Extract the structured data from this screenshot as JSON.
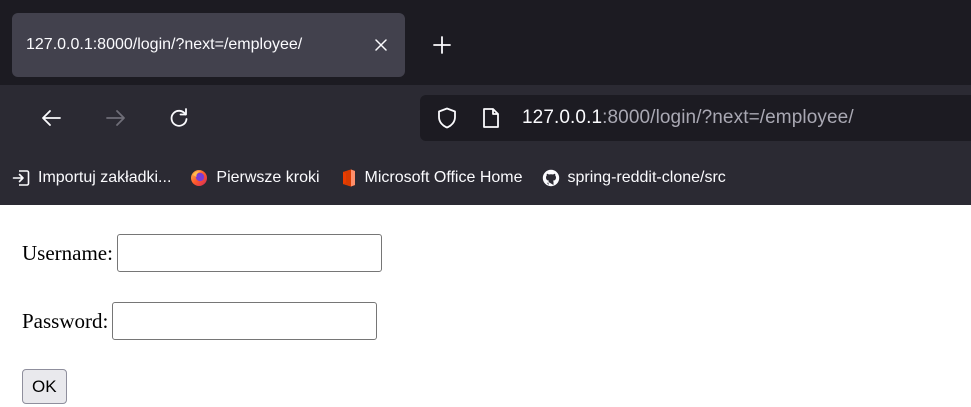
{
  "tab": {
    "title": "127.0.0.1:8000/login/?next=/employee/",
    "close_label": "×"
  },
  "newtab": {
    "label": "+"
  },
  "url": {
    "host": "127.0.0.1",
    "rest": ":8000/login/?next=/employee/"
  },
  "bookmarks": [
    {
      "label": "Importuj zakładki...",
      "icon": "import-icon"
    },
    {
      "label": "Pierwsze kroki",
      "icon": "firefox-icon"
    },
    {
      "label": "Microsoft Office Home",
      "icon": "office-icon"
    },
    {
      "label": "spring-reddit-clone/src",
      "icon": "github-icon"
    }
  ],
  "form": {
    "username_label": "Username:",
    "username_value": "",
    "password_label": "Password:",
    "password_value": "",
    "submit_label": "OK"
  },
  "colors": {
    "tabstrip_bg": "#1c1b22",
    "toolbar_bg": "#2b2a33",
    "active_tab_bg": "#42414d",
    "text_light": "#fbfbfe",
    "url_dim": "#a9a8b3"
  }
}
